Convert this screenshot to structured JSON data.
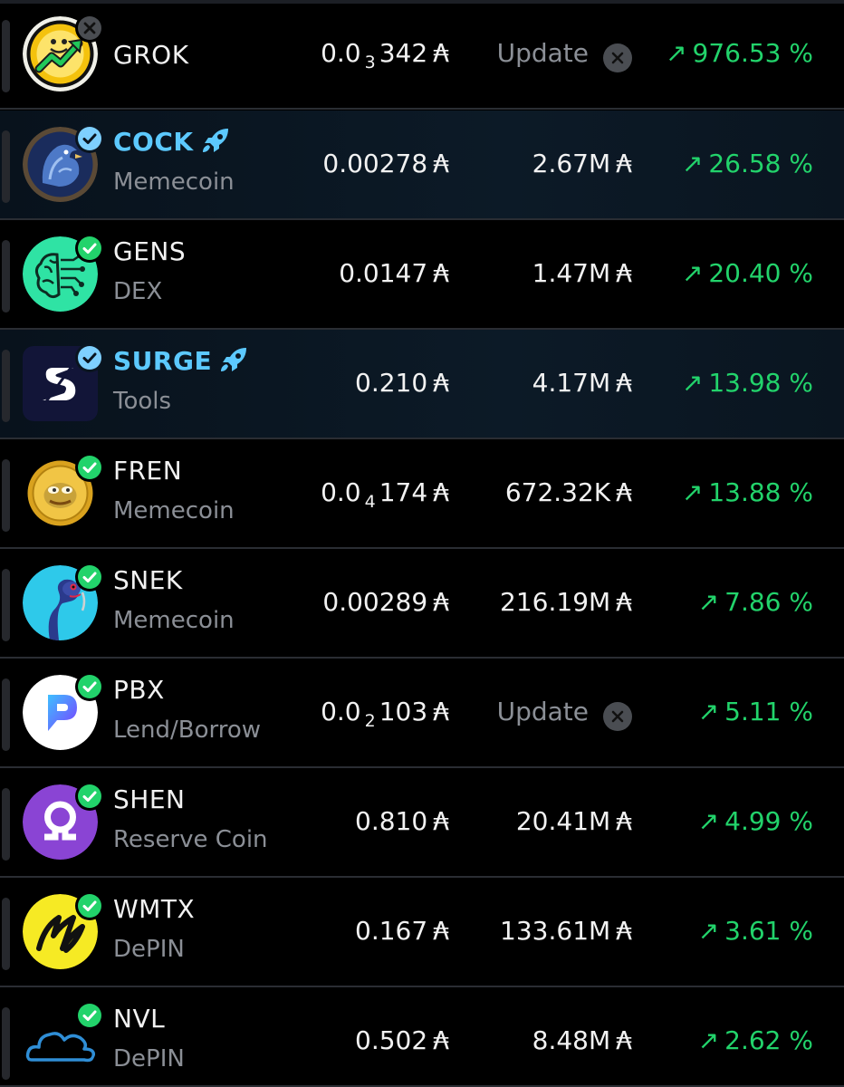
{
  "currency_symbol": "₳",
  "colors": {
    "positive": "#22d36b",
    "highlight_name": "#5cc9ff",
    "muted": "#8b8f96",
    "row_divider": "#2a2d33"
  },
  "rows": [
    {
      "name": "GROK",
      "category": "",
      "price": {
        "lead": "0.0",
        "zeros": "3",
        "digits": "342"
      },
      "volume": "",
      "volume_status": "Update",
      "change_arrow": "↗",
      "change": "976.53 %",
      "verified": false,
      "highlighted": false,
      "boosted": false,
      "logo_icon": "grok-coin-icon"
    },
    {
      "name": "COCK",
      "category": "Memecoin",
      "price": {
        "lead": "0.00278",
        "zeros": "",
        "digits": ""
      },
      "volume": "2.67M",
      "volume_status": "",
      "change_arrow": "↗",
      "change": "26.58 %",
      "verified": true,
      "highlighted": true,
      "boosted": true,
      "logo_icon": "rooster-coin-icon"
    },
    {
      "name": "GENS",
      "category": "DEX",
      "price": {
        "lead": "0.0147",
        "zeros": "",
        "digits": ""
      },
      "volume": "1.47M",
      "volume_status": "",
      "change_arrow": "↗",
      "change": "20.40 %",
      "verified": true,
      "highlighted": false,
      "boosted": false,
      "logo_icon": "brain-circuit-icon"
    },
    {
      "name": "SURGE",
      "category": "Tools",
      "price": {
        "lead": "0.210",
        "zeros": "",
        "digits": ""
      },
      "volume": "4.17M",
      "volume_status": "",
      "change_arrow": "↗",
      "change": "13.98 %",
      "verified": true,
      "highlighted": true,
      "boosted": true,
      "logo_icon": "surge-s-icon"
    },
    {
      "name": "FREN",
      "category": "Memecoin",
      "price": {
        "lead": "0.0",
        "zeros": "4",
        "digits": "174"
      },
      "volume": "672.32K",
      "volume_status": "",
      "change_arrow": "↗",
      "change": "13.88 %",
      "verified": true,
      "highlighted": false,
      "boosted": false,
      "logo_icon": "pepe-coin-icon"
    },
    {
      "name": "SNEK",
      "category": "Memecoin",
      "price": {
        "lead": "0.00289",
        "zeros": "",
        "digits": ""
      },
      "volume": "216.19M",
      "volume_status": "",
      "change_arrow": "↗",
      "change": "7.86 %",
      "verified": true,
      "highlighted": false,
      "boosted": false,
      "logo_icon": "snake-icon"
    },
    {
      "name": "PBX",
      "category": "Lend/Borrow",
      "price": {
        "lead": "0.0",
        "zeros": "2",
        "digits": "103"
      },
      "volume": "",
      "volume_status": "Update",
      "change_arrow": "↗",
      "change": "5.11 %",
      "verified": true,
      "highlighted": false,
      "boosted": false,
      "logo_icon": "pbx-p-icon"
    },
    {
      "name": "SHEN",
      "category": "Reserve Coin",
      "price": {
        "lead": "0.810",
        "zeros": "",
        "digits": ""
      },
      "volume": "20.41M",
      "volume_status": "",
      "change_arrow": "↗",
      "change": "4.99 %",
      "verified": true,
      "highlighted": false,
      "boosted": false,
      "logo_icon": "shen-omega-icon"
    },
    {
      "name": "WMTX",
      "category": "DePIN",
      "price": {
        "lead": "0.167",
        "zeros": "",
        "digits": ""
      },
      "volume": "133.61M",
      "volume_status": "",
      "change_arrow": "↗",
      "change": "3.61 %",
      "verified": true,
      "highlighted": false,
      "boosted": false,
      "logo_icon": "wmtx-w-icon"
    },
    {
      "name": "NVL",
      "category": "DePIN",
      "price": {
        "lead": "0.502",
        "zeros": "",
        "digits": ""
      },
      "volume": "8.48M",
      "volume_status": "",
      "change_arrow": "↗",
      "change": "2.62 %",
      "verified": true,
      "highlighted": false,
      "boosted": false,
      "logo_icon": "cloud-icon"
    }
  ]
}
